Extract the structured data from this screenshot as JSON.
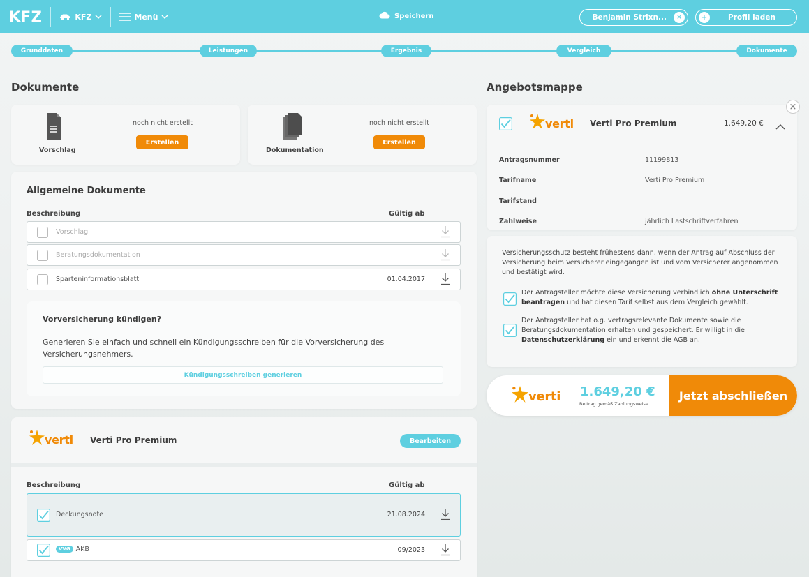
{
  "topbar": {
    "brand": "KFZ",
    "vehicle_dropdown": "KFZ",
    "menu_dropdown": "Menü",
    "save_label": "Speichern",
    "user_name": "Benjamin Strixn...",
    "user_clear": "×",
    "profile_plus": "+",
    "profile_label": "Profil laden",
    "accent_color": "#5ecfe0"
  },
  "steps": [
    "Grunddaten",
    "Leistungen",
    "Ergebnis",
    "Vergleich",
    "Dokumente"
  ],
  "documents": {
    "heading": "Dokumente",
    "cards": [
      {
        "label": "Vorschlag",
        "status": "noch nicht erstellt",
        "button": "Erstellen",
        "icon": "document-icon"
      },
      {
        "label": "Dokumentation",
        "status": "noch nicht erstellt",
        "button": "Erstellen",
        "icon": "documents-stack-icon"
      }
    ]
  },
  "general_docs": {
    "title": "Allgemeine Dokumente",
    "col_description": "Beschreibung",
    "col_valid_from": "Gültig ab",
    "rows": [
      {
        "label": "Vorschlag",
        "date": "",
        "enabled": false
      },
      {
        "label": "Beratungsdokumentation",
        "date": "",
        "enabled": false
      },
      {
        "label": "Sparteninformationsblatt",
        "date": "01.04.2017",
        "enabled": true
      }
    ],
    "cancel": {
      "title": "Vorversicherung kündigen?",
      "text": "Generieren Sie einfach und schnell ein Kündigungsschreiben für die Vorversicherung des Versicherungsnehmers.",
      "button": "Kündigungsschreiben generieren"
    }
  },
  "tariff_docs": {
    "logo_text": "verti",
    "tariff": "Verti Pro Premium",
    "edit_button": "Bearbeiten",
    "col_description": "Beschreibung",
    "col_valid_from": "Gültig ab",
    "rows": [
      {
        "label": "Deckungsnote",
        "date": "21.08.2024",
        "checked": true,
        "badge": ""
      },
      {
        "label": "AKB",
        "date": "09/2023",
        "checked": true,
        "badge": "VVG"
      }
    ]
  },
  "offer_folder": {
    "heading": "Angebotsmappe",
    "close": "×",
    "logo_text": "verti",
    "tariff": "Verti Pro Premium",
    "price": "1.649,20 €",
    "details": [
      {
        "key": "Antragsnummer",
        "value": "11199813"
      },
      {
        "key": "Tarifname",
        "value": "Verti Pro Premium"
      },
      {
        "key": "Tarifstand",
        "value": ""
      },
      {
        "key": "Zahlweise",
        "value": "jährlich Lastschriftverfahren"
      }
    ],
    "legal_text": "Versicherungsschutz besteht frühestens dann, wenn der Antrag auf Abschluss der Versicherung beim Versicherer eingegangen ist und vom Versicherer angenommen und bestätigt wird.",
    "consent1": {
      "pre": "Der Antragsteller möchte diese Versicherung verbindlich ",
      "bold": "ohne Unterschrift beantragen",
      "post": " und hat diesen Tarif selbst aus dem Vergleich gewählt."
    },
    "consent2": {
      "pre": "Der Antragsteller hat o.g. vertragsrelevante Dokumente sowie die Beratungsdokumentation erhalten und gespeichert. Er willigt in die ",
      "bold": "Datenschutzerklärung",
      "post": " ein und erkennt die AGB an."
    }
  },
  "checkout": {
    "logo_text": "verti",
    "price": "1.649,20 €",
    "price_label": "Beitrag gemäß Zahlungsweise",
    "cta": "Jetzt abschließen",
    "cta_color": "#f08a08"
  }
}
